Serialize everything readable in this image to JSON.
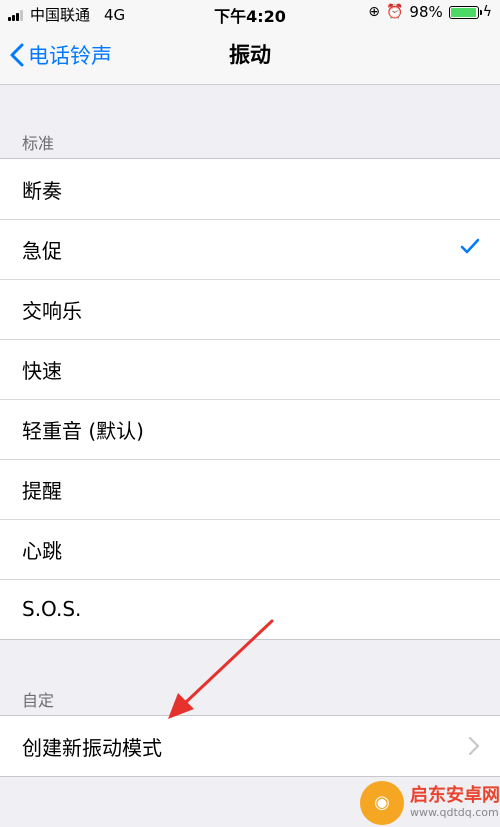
{
  "status_bar": {
    "carrier": "中国联通",
    "network": "4G",
    "time": "下午4:20",
    "battery_percent": "98%",
    "battery_level": 0.98
  },
  "nav": {
    "back_label": "电话铃声",
    "title": "振动"
  },
  "standard": {
    "header": "标准",
    "items": [
      {
        "label": "断奏",
        "selected": false
      },
      {
        "label": "急促",
        "selected": true
      },
      {
        "label": "交响乐",
        "selected": false
      },
      {
        "label": "快速",
        "selected": false
      },
      {
        "label": "轻重音 (默认)",
        "selected": false
      },
      {
        "label": "提醒",
        "selected": false
      },
      {
        "label": "心跳",
        "selected": false
      },
      {
        "label": "S.O.S.",
        "selected": false
      }
    ]
  },
  "custom": {
    "header": "自定",
    "create_label": "创建新振动模式"
  },
  "colors": {
    "accent": "#007aff",
    "annotation_arrow": "#e5322d",
    "battery": "#4cd964"
  },
  "watermark": {
    "title": "启东安卓网",
    "url": "www.qdtdq.com"
  }
}
